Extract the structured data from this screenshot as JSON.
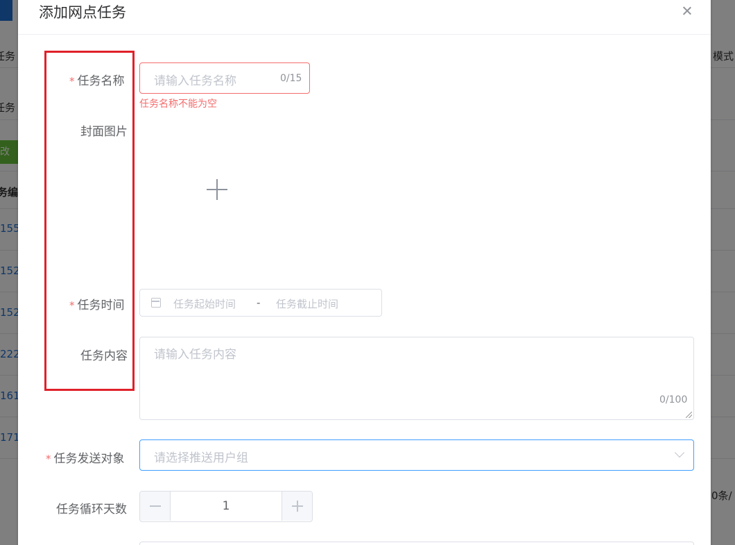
{
  "background": {
    "header_right": "模式",
    "col_left_1": "任务",
    "col_left_2": "任务",
    "green_button": "改",
    "table_header": "务编",
    "row_ids": [
      "155",
      "152",
      "152",
      "222",
      "161",
      "171"
    ],
    "pagination": "0条/"
  },
  "dialog": {
    "title": "添加网点任务",
    "form": {
      "required_mark": "*",
      "task_name": {
        "label": "任务名称",
        "placeholder": "请输入任务名称",
        "count": "0/15",
        "error": "任务名称不能为空"
      },
      "cover_image": {
        "label": "封面图片"
      },
      "task_time": {
        "label": "任务时间",
        "start_placeholder": "任务起始时间",
        "separator": "-",
        "end_placeholder": "任务截止时间"
      },
      "task_content": {
        "label": "任务内容",
        "placeholder": "请输入任务内容",
        "count": "0/100"
      },
      "send_target": {
        "label": "任务发送对象",
        "placeholder": "请选择推送用户组"
      },
      "cycle_days": {
        "label": "任务循环天数",
        "value": "1"
      }
    }
  },
  "colors": {
    "accent": "#409eff",
    "error": "#f56c6c",
    "annotation": "#e0202a"
  }
}
